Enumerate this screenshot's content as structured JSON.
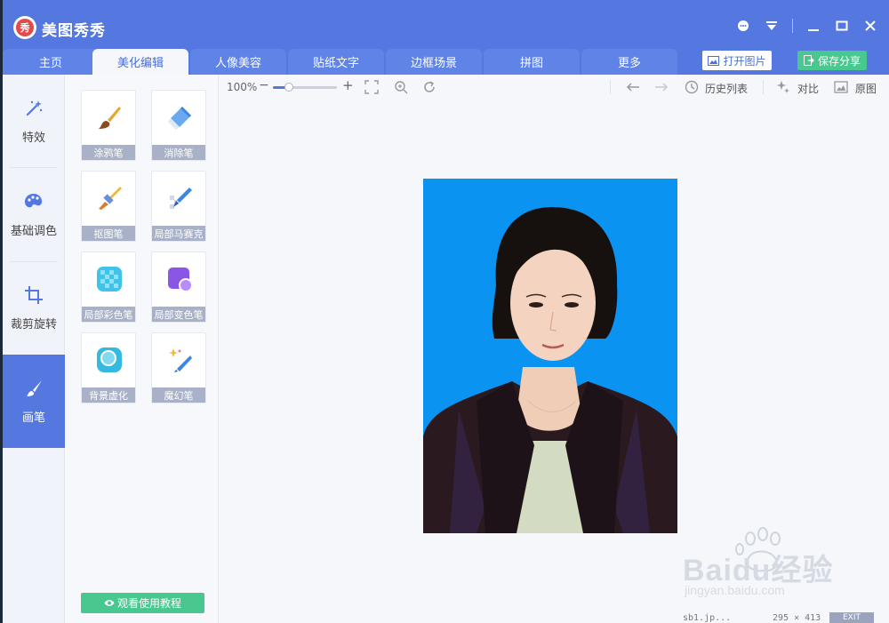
{
  "app": {
    "title": "美图秀秀"
  },
  "window_controls": [
    "chat-icon",
    "dropdown-icon",
    "minimize-icon",
    "maximize-icon",
    "close-icon"
  ],
  "tabs": [
    {
      "label": "主页",
      "active": false
    },
    {
      "label": "美化编辑",
      "active": true
    },
    {
      "label": "人像美容",
      "active": false
    },
    {
      "label": "贴纸文字",
      "active": false
    },
    {
      "label": "边框场景",
      "active": false
    },
    {
      "label": "拼图",
      "active": false
    },
    {
      "label": "更多",
      "active": false
    }
  ],
  "header_buttons": {
    "open": "打开图片",
    "save": "保存分享"
  },
  "leftnav": [
    {
      "label": "特效",
      "icon": "magic-wand-icon",
      "active": false
    },
    {
      "label": "基础调色",
      "icon": "palette-icon",
      "active": false
    },
    {
      "label": "裁剪旋转",
      "icon": "crop-icon",
      "active": false
    },
    {
      "label": "画笔",
      "icon": "brush-icon",
      "active": true
    }
  ],
  "tools": [
    {
      "label": "涂鸦笔",
      "icon": "paintbrush-icon"
    },
    {
      "label": "消除笔",
      "icon": "eraser-icon"
    },
    {
      "label": "抠图笔",
      "icon": "cutout-brush-icon"
    },
    {
      "label": "局部马赛克",
      "icon": "mosaic-pen-icon"
    },
    {
      "label": "局部彩色笔",
      "icon": "color-checker-icon"
    },
    {
      "label": "局部变色笔",
      "icon": "color-change-icon"
    },
    {
      "label": "背景虚化",
      "icon": "blur-bg-icon"
    },
    {
      "label": "魔幻笔",
      "icon": "magic-pen-icon"
    }
  ],
  "tutorial_button": "观看使用教程",
  "canvas_toolbar": {
    "zoom": "100%",
    "zoom_level": 0.25,
    "history": "历史列表",
    "compare": "对比",
    "original": "原图"
  },
  "photo": {
    "background_color": "#0a93f0"
  },
  "status": {
    "filename": "sb1.jp...",
    "size": "295 × 413",
    "exit": "EXIT"
  },
  "watermark": {
    "brand": "Baidu经验",
    "url": "jingyan.baidu.com"
  },
  "colors": {
    "primary": "#5478e0",
    "accent_green": "#48c78e",
    "label_gray": "#a8b1c7"
  }
}
